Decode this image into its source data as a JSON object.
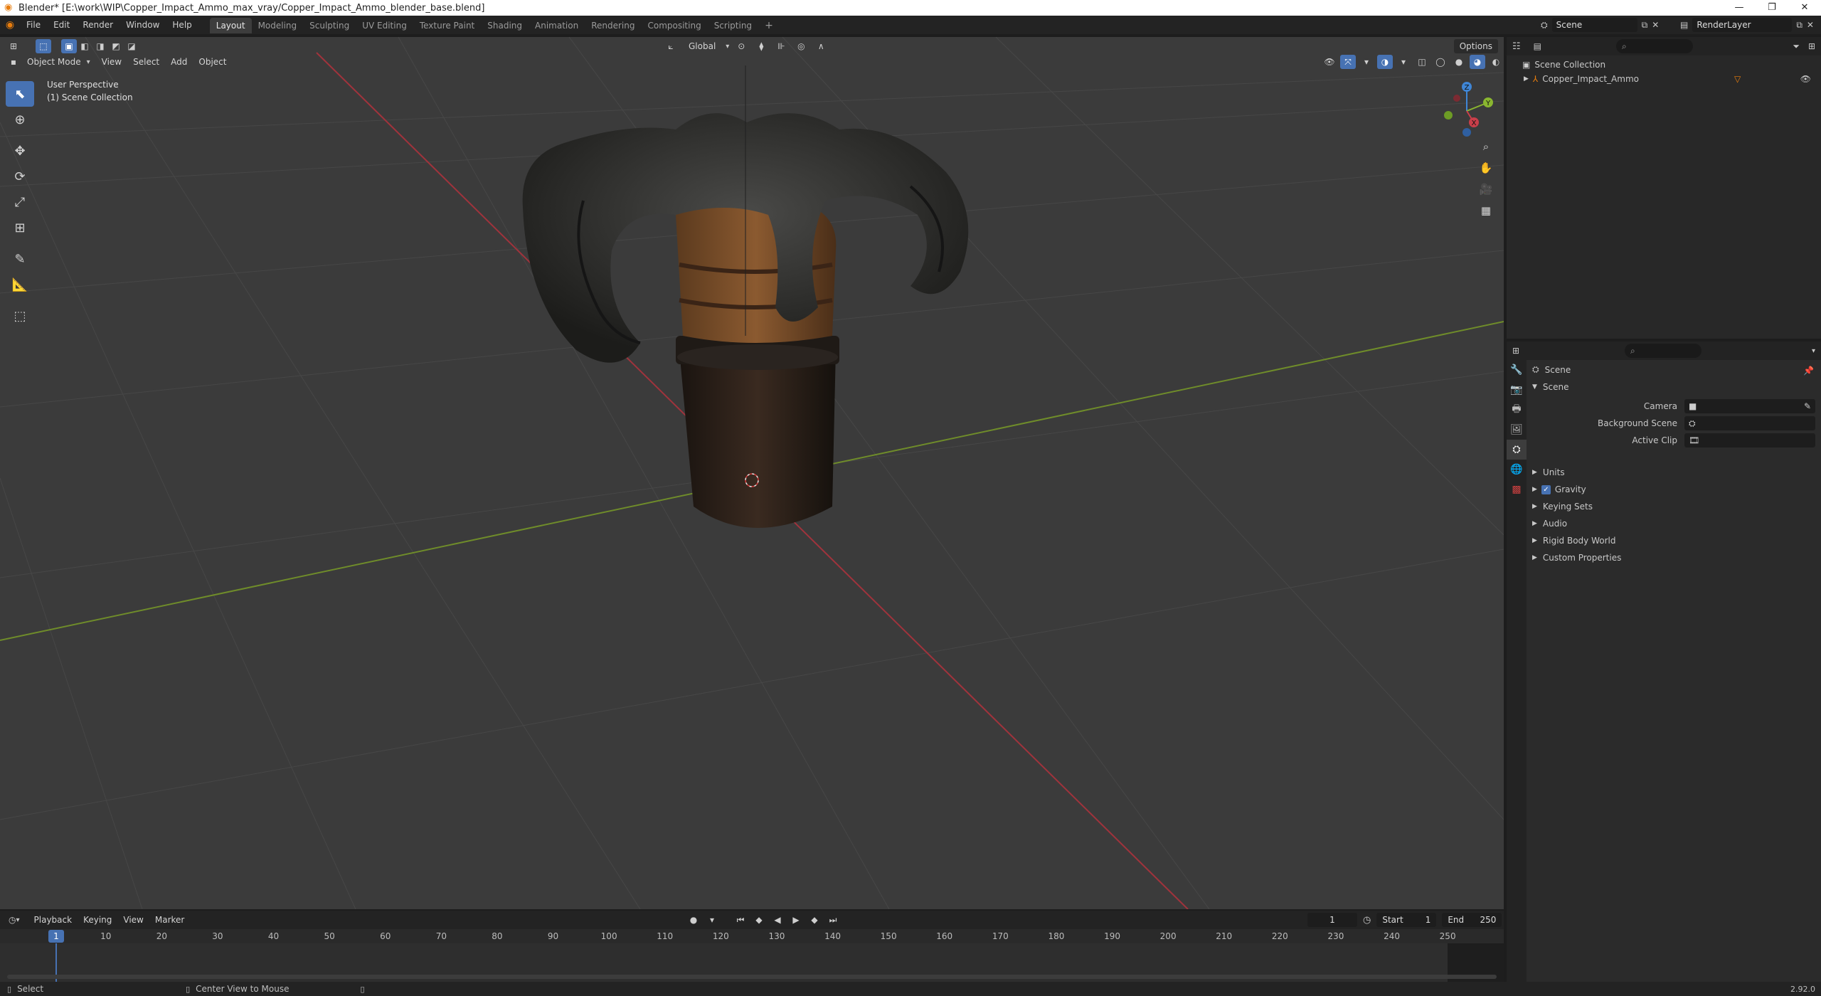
{
  "window": {
    "title": "Blender* [E:\\work\\WIP\\Copper_Impact_Ammo_max_vray/Copper_Impact_Ammo_blender_base.blend]",
    "minimize": "—",
    "maximize": "❐",
    "close": "✕"
  },
  "menu": [
    "File",
    "Edit",
    "Render",
    "Window",
    "Help"
  ],
  "workspaces": [
    "Layout",
    "Modeling",
    "Sculpting",
    "UV Editing",
    "Texture Paint",
    "Shading",
    "Animation",
    "Rendering",
    "Compositing",
    "Scripting"
  ],
  "active_workspace": "Layout",
  "add_workspace": "+",
  "scene_selector": "Scene",
  "view_layer": "RenderLayer",
  "viewport": {
    "transform_orientation": "Global",
    "options": "Options",
    "mode": "Object Mode",
    "menus": [
      "View",
      "Select",
      "Add",
      "Object"
    ],
    "overlay_line1": "User Perspective",
    "overlay_line2": "(1) Scene Collection",
    "gizmo_axes": {
      "x": "X",
      "y": "Y",
      "z": "Z"
    }
  },
  "outliner": {
    "root": "Scene Collection",
    "items": [
      {
        "name": "Copper_Impact_Ammo"
      }
    ]
  },
  "properties": {
    "context_name": "Scene",
    "panel_title": "Scene",
    "fields": [
      {
        "label": "Camera",
        "value": ""
      },
      {
        "label": "Background Scene",
        "value": ""
      },
      {
        "label": "Active Clip",
        "value": ""
      }
    ],
    "subpanels": [
      "Units",
      "Gravity",
      "Keying Sets",
      "Audio",
      "Rigid Body World",
      "Custom Properties"
    ],
    "gravity_checked": true
  },
  "timeline": {
    "menus": [
      "Playback",
      "Keying",
      "View",
      "Marker"
    ],
    "current_frame": "1",
    "start_label": "Start",
    "start": "1",
    "end_label": "End",
    "end": "250",
    "ticks": [
      "10",
      "20",
      "30",
      "40",
      "50",
      "60",
      "70",
      "80",
      "90",
      "100",
      "110",
      "120",
      "130",
      "140",
      "150",
      "160",
      "170",
      "180",
      "190",
      "200",
      "210",
      "220",
      "230",
      "240",
      "250"
    ],
    "playhead_label": "1"
  },
  "statusbar": {
    "left": "Select",
    "middle": "Center View to Mouse",
    "version": "2.92.0"
  },
  "colors": {
    "accent": "#4772b3",
    "x_axis": "#c93f4a",
    "y_axis": "#8ab630",
    "z_axis": "#3f86d6",
    "viewport_bg": "#3b3b3b"
  }
}
